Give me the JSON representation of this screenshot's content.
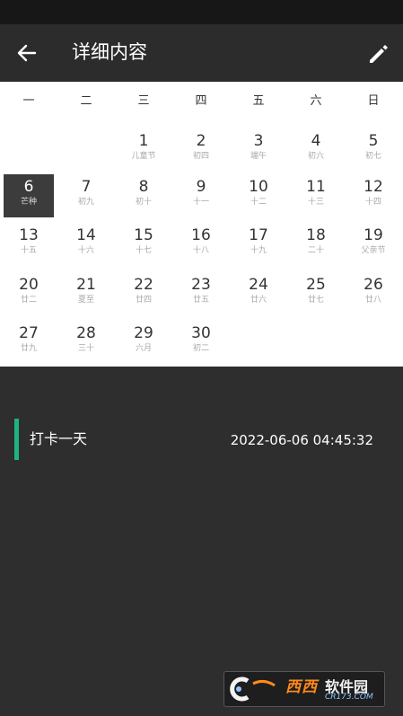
{
  "app_bar": {
    "title": "详细内容",
    "back_icon": "arrow-left-icon",
    "edit_icon": "pencil-icon"
  },
  "calendar": {
    "weekdays": [
      "一",
      "二",
      "三",
      "四",
      "五",
      "六",
      "日"
    ],
    "selected_day": "6",
    "weeks": [
      [
        null,
        null,
        {
          "day": "1",
          "sub": "儿童节"
        },
        {
          "day": "2",
          "sub": "初四"
        },
        {
          "day": "3",
          "sub": "端午"
        },
        {
          "day": "4",
          "sub": "初六"
        },
        {
          "day": "5",
          "sub": "初七"
        }
      ],
      [
        {
          "day": "6",
          "sub": "芒种"
        },
        {
          "day": "7",
          "sub": "初九"
        },
        {
          "day": "8",
          "sub": "初十"
        },
        {
          "day": "9",
          "sub": "十一"
        },
        {
          "day": "10",
          "sub": "十二"
        },
        {
          "day": "11",
          "sub": "十三"
        },
        {
          "day": "12",
          "sub": "十四"
        }
      ],
      [
        {
          "day": "13",
          "sub": "十五"
        },
        {
          "day": "14",
          "sub": "十六"
        },
        {
          "day": "15",
          "sub": "十七"
        },
        {
          "day": "16",
          "sub": "十八"
        },
        {
          "day": "17",
          "sub": "十九"
        },
        {
          "day": "18",
          "sub": "二十"
        },
        {
          "day": "19",
          "sub": "父亲节"
        }
      ],
      [
        {
          "day": "20",
          "sub": "廿二"
        },
        {
          "day": "21",
          "sub": "夏至"
        },
        {
          "day": "22",
          "sub": "廿四"
        },
        {
          "day": "23",
          "sub": "廿五"
        },
        {
          "day": "24",
          "sub": "廿六"
        },
        {
          "day": "25",
          "sub": "廿七"
        },
        {
          "day": "26",
          "sub": "廿八"
        }
      ],
      [
        {
          "day": "27",
          "sub": "廿九"
        },
        {
          "day": "28",
          "sub": "三十"
        },
        {
          "day": "29",
          "sub": "六月"
        },
        {
          "day": "30",
          "sub": "初二"
        },
        null,
        null,
        null
      ]
    ]
  },
  "record": {
    "text": "打卡一天",
    "timestamp": "2022-06-06 04:45:32",
    "accent_color": "#1db37e"
  },
  "watermark": {
    "brand": "西西",
    "label": "软件园",
    "url": "CR173.COM"
  }
}
